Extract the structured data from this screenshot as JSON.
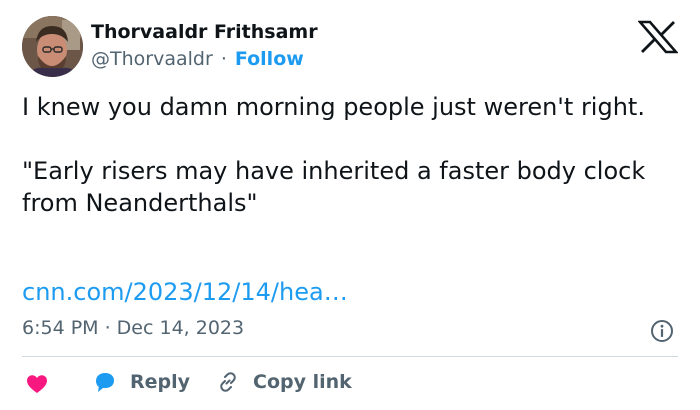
{
  "author": {
    "name": "Thorvaaldr Frithsamr",
    "handle": "@Thorvaaldr",
    "separator": "·",
    "follow_label": "Follow"
  },
  "tweet": {
    "text": "I knew you damn morning people just weren't right.\n\n\"Early risers may have inherited a faster body clock from Neanderthals\"",
    "link": "cnn.com/2023/12/14/hea…",
    "timestamp": "6:54 PM · Dec 14, 2023"
  },
  "actions": {
    "reply_label": "Reply",
    "copy_link_label": "Copy link"
  },
  "icons": {
    "logo": "x-logo-icon",
    "info": "info-icon",
    "like": "heart-icon",
    "reply": "reply-bubble-icon",
    "copy": "link-icon"
  },
  "colors": {
    "accent": "#1d9bf0",
    "heart": "#f91880",
    "muted": "#536471",
    "text": "#0f1419",
    "divider": "#cfd9de"
  }
}
